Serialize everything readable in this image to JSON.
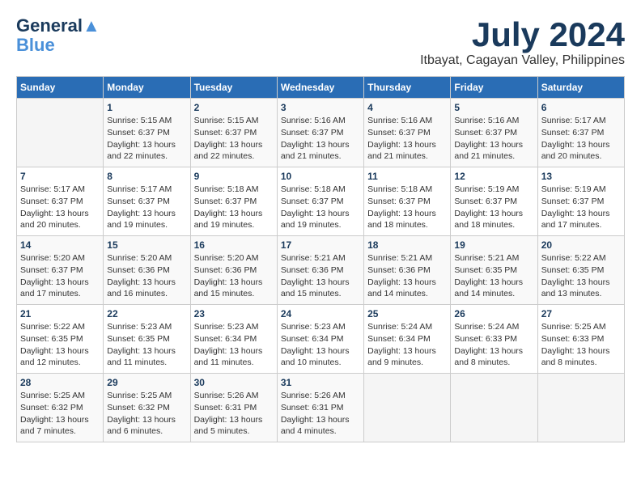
{
  "logo": {
    "line1": "General",
    "line2": "Blue"
  },
  "title": "July 2024",
  "location": "Itbayat, Cagayan Valley, Philippines",
  "days_of_week": [
    "Sunday",
    "Monday",
    "Tuesday",
    "Wednesday",
    "Thursday",
    "Friday",
    "Saturday"
  ],
  "weeks": [
    [
      {
        "day": "",
        "info": ""
      },
      {
        "day": "1",
        "info": "Sunrise: 5:15 AM\nSunset: 6:37 PM\nDaylight: 13 hours\nand 22 minutes."
      },
      {
        "day": "2",
        "info": "Sunrise: 5:15 AM\nSunset: 6:37 PM\nDaylight: 13 hours\nand 22 minutes."
      },
      {
        "day": "3",
        "info": "Sunrise: 5:16 AM\nSunset: 6:37 PM\nDaylight: 13 hours\nand 21 minutes."
      },
      {
        "day": "4",
        "info": "Sunrise: 5:16 AM\nSunset: 6:37 PM\nDaylight: 13 hours\nand 21 minutes."
      },
      {
        "day": "5",
        "info": "Sunrise: 5:16 AM\nSunset: 6:37 PM\nDaylight: 13 hours\nand 21 minutes."
      },
      {
        "day": "6",
        "info": "Sunrise: 5:17 AM\nSunset: 6:37 PM\nDaylight: 13 hours\nand 20 minutes."
      }
    ],
    [
      {
        "day": "7",
        "info": "Sunrise: 5:17 AM\nSunset: 6:37 PM\nDaylight: 13 hours\nand 20 minutes."
      },
      {
        "day": "8",
        "info": "Sunrise: 5:17 AM\nSunset: 6:37 PM\nDaylight: 13 hours\nand 19 minutes."
      },
      {
        "day": "9",
        "info": "Sunrise: 5:18 AM\nSunset: 6:37 PM\nDaylight: 13 hours\nand 19 minutes."
      },
      {
        "day": "10",
        "info": "Sunrise: 5:18 AM\nSunset: 6:37 PM\nDaylight: 13 hours\nand 19 minutes."
      },
      {
        "day": "11",
        "info": "Sunrise: 5:18 AM\nSunset: 6:37 PM\nDaylight: 13 hours\nand 18 minutes."
      },
      {
        "day": "12",
        "info": "Sunrise: 5:19 AM\nSunset: 6:37 PM\nDaylight: 13 hours\nand 18 minutes."
      },
      {
        "day": "13",
        "info": "Sunrise: 5:19 AM\nSunset: 6:37 PM\nDaylight: 13 hours\nand 17 minutes."
      }
    ],
    [
      {
        "day": "14",
        "info": "Sunrise: 5:20 AM\nSunset: 6:37 PM\nDaylight: 13 hours\nand 17 minutes."
      },
      {
        "day": "15",
        "info": "Sunrise: 5:20 AM\nSunset: 6:36 PM\nDaylight: 13 hours\nand 16 minutes."
      },
      {
        "day": "16",
        "info": "Sunrise: 5:20 AM\nSunset: 6:36 PM\nDaylight: 13 hours\nand 15 minutes."
      },
      {
        "day": "17",
        "info": "Sunrise: 5:21 AM\nSunset: 6:36 PM\nDaylight: 13 hours\nand 15 minutes."
      },
      {
        "day": "18",
        "info": "Sunrise: 5:21 AM\nSunset: 6:36 PM\nDaylight: 13 hours\nand 14 minutes."
      },
      {
        "day": "19",
        "info": "Sunrise: 5:21 AM\nSunset: 6:35 PM\nDaylight: 13 hours\nand 14 minutes."
      },
      {
        "day": "20",
        "info": "Sunrise: 5:22 AM\nSunset: 6:35 PM\nDaylight: 13 hours\nand 13 minutes."
      }
    ],
    [
      {
        "day": "21",
        "info": "Sunrise: 5:22 AM\nSunset: 6:35 PM\nDaylight: 13 hours\nand 12 minutes."
      },
      {
        "day": "22",
        "info": "Sunrise: 5:23 AM\nSunset: 6:35 PM\nDaylight: 13 hours\nand 11 minutes."
      },
      {
        "day": "23",
        "info": "Sunrise: 5:23 AM\nSunset: 6:34 PM\nDaylight: 13 hours\nand 11 minutes."
      },
      {
        "day": "24",
        "info": "Sunrise: 5:23 AM\nSunset: 6:34 PM\nDaylight: 13 hours\nand 10 minutes."
      },
      {
        "day": "25",
        "info": "Sunrise: 5:24 AM\nSunset: 6:34 PM\nDaylight: 13 hours\nand 9 minutes."
      },
      {
        "day": "26",
        "info": "Sunrise: 5:24 AM\nSunset: 6:33 PM\nDaylight: 13 hours\nand 8 minutes."
      },
      {
        "day": "27",
        "info": "Sunrise: 5:25 AM\nSunset: 6:33 PM\nDaylight: 13 hours\nand 8 minutes."
      }
    ],
    [
      {
        "day": "28",
        "info": "Sunrise: 5:25 AM\nSunset: 6:32 PM\nDaylight: 13 hours\nand 7 minutes."
      },
      {
        "day": "29",
        "info": "Sunrise: 5:25 AM\nSunset: 6:32 PM\nDaylight: 13 hours\nand 6 minutes."
      },
      {
        "day": "30",
        "info": "Sunrise: 5:26 AM\nSunset: 6:31 PM\nDaylight: 13 hours\nand 5 minutes."
      },
      {
        "day": "31",
        "info": "Sunrise: 5:26 AM\nSunset: 6:31 PM\nDaylight: 13 hours\nand 4 minutes."
      },
      {
        "day": "",
        "info": ""
      },
      {
        "day": "",
        "info": ""
      },
      {
        "day": "",
        "info": ""
      }
    ]
  ]
}
